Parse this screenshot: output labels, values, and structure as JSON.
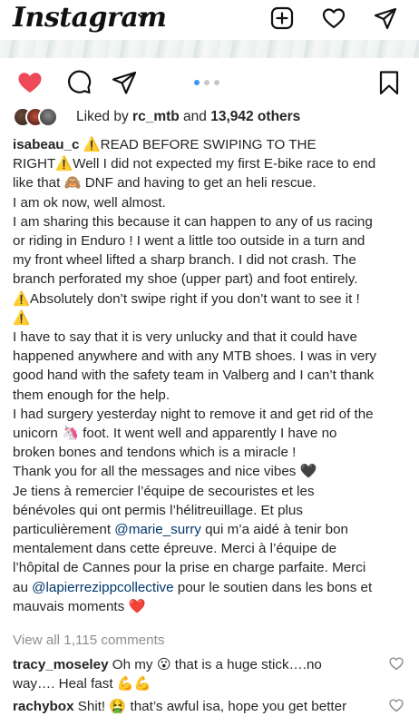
{
  "header": {
    "app_name": "Instagram",
    "icons": [
      "chevron-down-icon",
      "new-post-icon",
      "heart-icon",
      "direct-message-icon"
    ]
  },
  "post": {
    "carousel_dots": 3,
    "active_dot": 1,
    "liked_by": {
      "prefix": "Liked by ",
      "user": "rc_mtb",
      "middle": " and ",
      "count": "13,942 others"
    },
    "caption": {
      "username": "isabeau_c",
      "line1": " ⚠️READ BEFORE SWIPING TO THE",
      "line2": "RIGHT⚠️Well I did not expected my first E-bike race to end",
      "line3": "like that 🙈 DNF and having to get an heli rescue.",
      "line4": "I am ok now, well almost.",
      "line5": "I am sharing this because it can happen to any of us racing",
      "line6": "or riding in Enduro ! I went a little too outside in a turn and",
      "line7": "my front wheel lifted a sharp branch. I did not crash. The",
      "line8": "branch perforated my shoe (upper part) and foot entirely.",
      "line9": "⚠️Absolutely don’t swipe right if you don’t want to see it !",
      "line10": "⚠️",
      "line11": "I have to say that it is very unlucky and that it could have",
      "line12": "happened anywhere and with any MTB shoes. I was in very",
      "line13": "good hand with the safety team in Valberg and I can’t thank",
      "line14": "them enough for the help.",
      "line15": "I had surgery yesterday night to remove it and get rid of the",
      "line16": "unicorn 🦄 foot. It went well and apparently I have no",
      "line17": "broken bones and tendons which is a miracle !",
      "line18": "Thank you for all the messages and nice vibes 🖤",
      "line19": "Je tiens à remercier l’équipe de secouristes et les",
      "line20": "bénévoles qui ont permis l’hélitreuillage. Et plus",
      "line21_pre": "particulièrement ",
      "mention1": "@marie_surry",
      "line21_post": " qui m’a aidé à tenir bon",
      "line22": "mentalement dans cette épreuve. Merci à l’équipe de",
      "line23": "l’hôpital de Cannes pour la prise en charge parfaite. Merci",
      "line24_pre": "au ",
      "mention2": "@lapierrezippcollective",
      "line24_post": " pour le soutien dans les bons et",
      "line25": "mauvais moments ❤️"
    },
    "view_all_comments": "View all 1,115 comments",
    "comments": [
      {
        "user": "tracy_moseley",
        "text1": " Oh my 😮 that is a huge stick….no",
        "text2": "way…. Heal fast 💪💪"
      },
      {
        "user": "rachybox",
        "text1": " Shit! 🤮 that’s awful isa, hope you get better",
        "text2": ""
      }
    ]
  },
  "colors": {
    "like_red": "#ed4956",
    "link_blue": "#00376b",
    "muted": "#8e8e8e",
    "dot_active": "#3897f0"
  }
}
